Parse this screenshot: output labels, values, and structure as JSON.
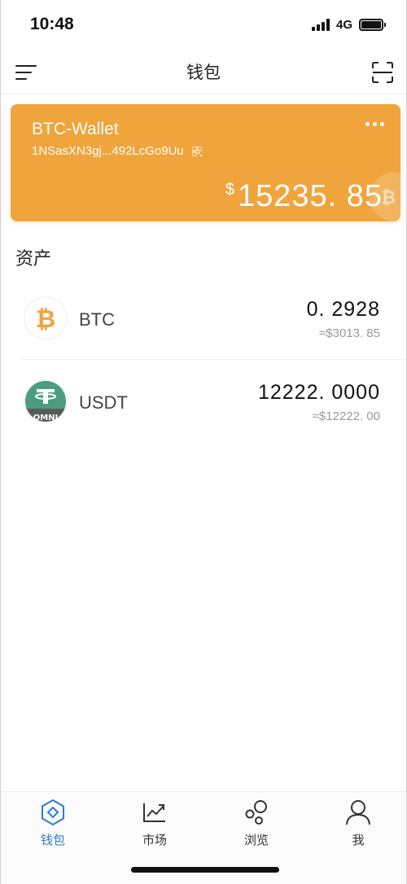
{
  "status_bar": {
    "time": "10:48",
    "network": "4G",
    "icons": [
      "signal-icon",
      "battery-icon"
    ]
  },
  "nav": {
    "title": "钱包",
    "left_icon": "menu-icon",
    "right_icon": "scan-icon"
  },
  "wallet": {
    "name": "BTC-Wallet",
    "address": "1NSasXN3gj...492LcGo9Uu",
    "balance_currency": "$",
    "balance": "15235. 85",
    "card_color": "#f0a43c"
  },
  "assets": {
    "title": "资产",
    "items": [
      {
        "name": "BTC",
        "amount": "0. 2928",
        "fiat": "≈$3013. 85",
        "icon": "bitcoin-icon",
        "icon_color": "#f0a43c"
      },
      {
        "name": "USDT",
        "amount": "12222. 0000",
        "fiat": "≈$12222. 00",
        "icon": "tether-omni-icon",
        "icon_color": "#4a9e7f",
        "icon_badge": "OMNI"
      }
    ]
  },
  "tabs": [
    {
      "label": "钱包",
      "icon": "wallet-icon",
      "active": true
    },
    {
      "label": "市场",
      "icon": "market-icon",
      "active": false
    },
    {
      "label": "浏览",
      "icon": "browse-icon",
      "active": false
    },
    {
      "label": "我",
      "icon": "profile-icon",
      "active": false
    }
  ],
  "colors": {
    "accent": "#2d7dd2",
    "card": "#f0a43c",
    "muted_text": "#999999"
  }
}
